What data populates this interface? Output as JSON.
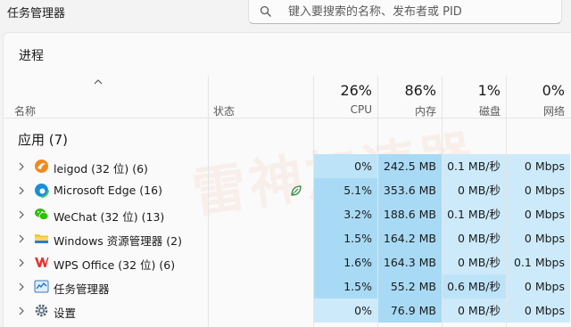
{
  "window": {
    "title": "任务管理器"
  },
  "search": {
    "placeholder": "键入要搜索的名称、发布者或 PID"
  },
  "page": {
    "title": "进程"
  },
  "columns": {
    "name": "名称",
    "status": "状态",
    "cpu": {
      "percent": "26%",
      "label": "CPU"
    },
    "memory": {
      "percent": "86%",
      "label": "内存"
    },
    "disk": {
      "percent": "1%",
      "label": "磁盘"
    },
    "network": {
      "percent": "0%",
      "label": "网络"
    }
  },
  "group": {
    "title": "应用 (7)"
  },
  "processes": [
    {
      "name": "leigod (32 位) (6)",
      "icon": "leigod-icon",
      "cpu": "0%",
      "memory": "242.5 MB",
      "disk": "0.1 MB/秒",
      "network": "0 Mbps"
    },
    {
      "name": "Microsoft Edge (16)",
      "icon": "edge-icon",
      "status_icon": "efficiency-leaf-icon",
      "cpu": "5.1%",
      "memory": "353.6 MB",
      "disk": "0 MB/秒",
      "network": "0 Mbps"
    },
    {
      "name": "WeChat (32 位) (13)",
      "icon": "wechat-icon",
      "cpu": "3.2%",
      "memory": "188.6 MB",
      "disk": "0.1 MB/秒",
      "network": "0 Mbps"
    },
    {
      "name": "Windows 资源管理器 (2)",
      "icon": "explorer-folder-icon",
      "cpu": "1.5%",
      "memory": "164.2 MB",
      "disk": "0 MB/秒",
      "network": "0 Mbps"
    },
    {
      "name": "WPS Office (32 位) (6)",
      "icon": "wps-icon",
      "cpu": "1.6%",
      "memory": "164.3 MB",
      "disk": "0 MB/秒",
      "network": "0.1 Mbps"
    },
    {
      "name": "任务管理器",
      "icon": "task-manager-icon",
      "cpu": "1.5%",
      "memory": "55.2 MB",
      "disk": "0.6 MB/秒",
      "network": "0 Mbps"
    },
    {
      "name": "设置",
      "icon": "settings-gear-icon",
      "cpu": "0%",
      "memory": "76.9 MB",
      "disk": "0 MB/秒",
      "network": "0 Mbps"
    }
  ],
  "watermark": {
    "text": "雷神加速器"
  },
  "colors": {
    "heat_dark": "#a8daf5",
    "heat_mid": "#bde3f8",
    "heat_light": "#cdeafa",
    "heat_lighter": "#d9f0fc"
  }
}
